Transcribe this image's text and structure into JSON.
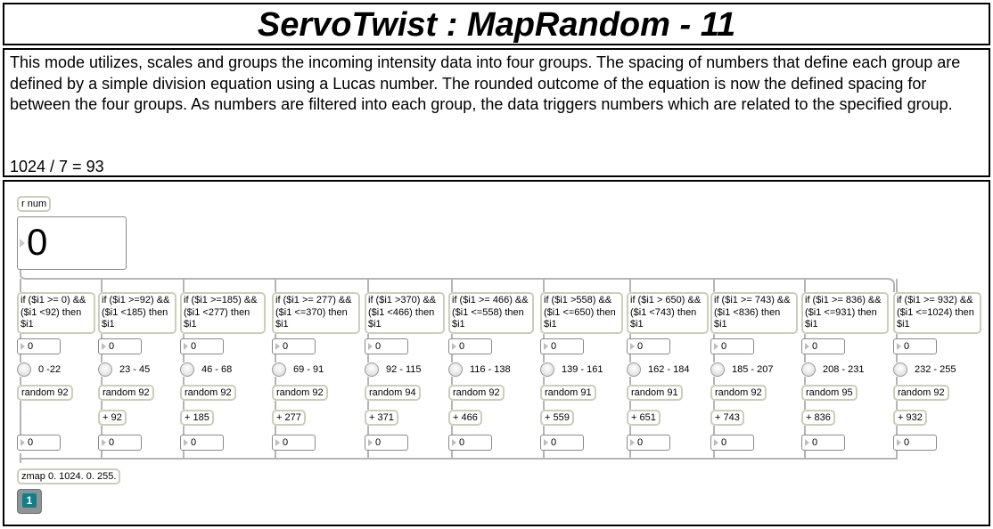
{
  "header": {
    "title": "ServoTwist : MapRandom - 11"
  },
  "description": {
    "text": "This mode utilizes, scales and groups the incoming intensity data into four groups. The spacing of numbers that define each group are defined by a simple division equation using a Lucas number. The rounded outcome of the equation is now the defined spacing for between the four groups. As numbers are filtered into each group, the data triggers numbers which are related to the specified group.",
    "equation": "1024 / 7 = 93"
  },
  "patch": {
    "receive_label": "r num",
    "input_value": "0",
    "zmap_label": "zmap 0. 1024. 0. 255.",
    "send_badge": "1",
    "columns": [
      {
        "condition": "if ($i1 >= 0) && ($i1 <92) then $i1",
        "in_value": "0",
        "range": "0 -22",
        "random": "random 92",
        "add": "",
        "out_value": "0"
      },
      {
        "condition": "if ($i1 >=92) && ($i1 <185) then $i1",
        "in_value": "0",
        "range": "23 - 45",
        "random": "random 92",
        "add": "+ 92",
        "out_value": "0"
      },
      {
        "condition": "if ($i1 >=185) && ($i1 <277) then $i1",
        "in_value": "0",
        "range": "46 - 68",
        "random": "random 92",
        "add": "+ 185",
        "out_value": "0"
      },
      {
        "condition": "if ($i1 >= 277) && ($i1 <=370) then $i1",
        "in_value": "0",
        "range": "69 - 91",
        "random": "random 92",
        "add": "+ 277",
        "out_value": "0"
      },
      {
        "condition": "if ($i1 >370) && ($i1 <466) then $i1",
        "in_value": "0",
        "range": "92 - 115",
        "random": "random 94",
        "add": "+ 371",
        "out_value": "0"
      },
      {
        "condition": "if ($i1 >= 466) && ($i1 <=558) then $i1",
        "in_value": "0",
        "range": "116 - 138",
        "random": "random 92",
        "add": "+ 466",
        "out_value": "0"
      },
      {
        "condition": "if ($i1 >558) && ($i1 <=650) then $i1",
        "in_value": "0",
        "range": "139 - 161",
        "random": "random 91",
        "add": "+ 559",
        "out_value": "0"
      },
      {
        "condition": "if ($i1 > 650) && ($i1 <743) then $i1",
        "in_value": "0",
        "range": "162 - 184",
        "random": "random 91",
        "add": "+ 651",
        "out_value": "0"
      },
      {
        "condition": "if ($i1 >= 743) && ($i1 <836) then $i1",
        "in_value": "0",
        "range": "185 - 207",
        "random": "random 92",
        "add": "+ 743",
        "out_value": "0"
      },
      {
        "condition": "if ($i1 >= 836) && ($i1 <=931) then $i1",
        "in_value": "0",
        "range": "208 - 231",
        "random": "random 95",
        "add": "+ 836",
        "out_value": "0"
      },
      {
        "condition": "if ($i1 >= 932) && ($i1 <=1024) then $i1",
        "in_value": "0",
        "range": "232 - 255",
        "random": "random 92",
        "add": "+ 932",
        "out_value": "0"
      }
    ]
  },
  "colors": {
    "object_border": "#c9cfb8",
    "patch_cord": "#b5b5b5",
    "send_badge": "#117f8a"
  }
}
